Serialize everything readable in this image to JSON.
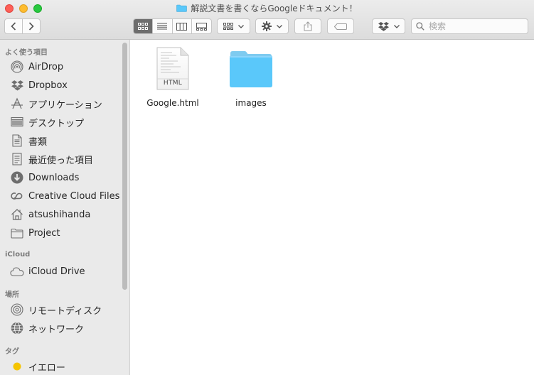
{
  "window": {
    "title": "解説文書を書くならGoogleドキュメント！"
  },
  "toolbar": {
    "view_modes": [
      "icon-view",
      "list-view",
      "column-view",
      "gallery-view"
    ],
    "active_view": "icon-view",
    "search_placeholder": "検索"
  },
  "sidebar": {
    "sections": {
      "favorites": "よく使う項目",
      "icloud": "iCloud",
      "locations": "場所",
      "tags": "タグ"
    },
    "favorites": [
      {
        "label": "AirDrop",
        "icon": "airdrop-icon"
      },
      {
        "label": "Dropbox",
        "icon": "dropbox-icon"
      },
      {
        "label": "アプリケーション",
        "icon": "applications-icon"
      },
      {
        "label": "デスクトップ",
        "icon": "desktop-icon"
      },
      {
        "label": "書類",
        "icon": "documents-icon"
      },
      {
        "label": "最近使った項目",
        "icon": "recents-icon"
      },
      {
        "label": "Downloads",
        "icon": "downloads-icon"
      },
      {
        "label": "Creative Cloud Files",
        "icon": "creative-cloud-icon"
      },
      {
        "label": "atsushihanda",
        "icon": "home-icon"
      },
      {
        "label": "Project",
        "icon": "folder-icon"
      }
    ],
    "icloud": [
      {
        "label": "iCloud Drive",
        "icon": "cloud-icon"
      }
    ],
    "locations": [
      {
        "label": "リモートディスク",
        "icon": "remote-disc-icon"
      },
      {
        "label": "ネットワーク",
        "icon": "network-icon"
      }
    ],
    "tags": [
      {
        "label": "イエロー",
        "color": "#f5c400"
      }
    ]
  },
  "files": [
    {
      "name": "Google.html",
      "type_label": "HTML",
      "icon": "html-file-icon"
    },
    {
      "name": "images",
      "icon": "folder-icon"
    }
  ],
  "colors": {
    "folder": "#5ac8fa",
    "folder_tab": "#7ecbf0",
    "tag_yellow": "#f5c400"
  }
}
